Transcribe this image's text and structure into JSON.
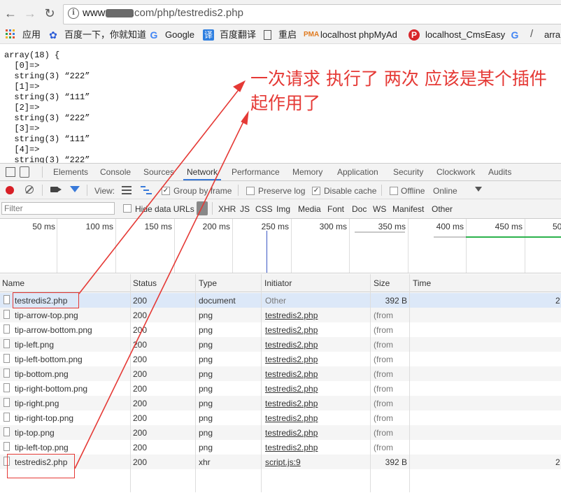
{
  "browser": {
    "url_host_prefix": "www.",
    "url_rest": ".com/php/testredis2.php"
  },
  "bookmarks": [
    {
      "label": "应用",
      "icon": "apps-grid-icon"
    },
    {
      "label": "百度一下，你就知道",
      "icon": "baidu-paw-icon"
    },
    {
      "label": "Google",
      "icon": "google-icon"
    },
    {
      "label": "百度翻译",
      "icon": "baidu-translate-icon"
    },
    {
      "label": "重启",
      "icon": "page-icon"
    },
    {
      "label": "localhost phpMyAd",
      "icon": "phpmyadmin-icon"
    },
    {
      "label": "localhost_CmsEasy",
      "icon": "cmseasy-icon"
    },
    {
      "label": "arra",
      "icon": "google-icon"
    }
  ],
  "page": {
    "dump_text": "array(18) {\n  [0]=>\n  string(3) “222”\n  [1]=>\n  string(3) “111”\n  [2]=>\n  string(3) “222”\n  [3]=>\n  string(3) “111”\n  [4]=>\n  string(3) “222”",
    "annotation": "一次请求 执行了 两次 应该是某个插件起作用了"
  },
  "devtools": {
    "tabs": [
      "Elements",
      "Console",
      "Sources",
      "Network",
      "Performance",
      "Memory",
      "Application",
      "Security",
      "Clockwork",
      "Audits"
    ],
    "active_tab": "Network",
    "toolbar": {
      "view_label": "View:",
      "group_by_frame": "Group by frame",
      "preserve_log": "Preserve log",
      "disable_cache": "Disable cache",
      "offline": "Offline",
      "throttle": "Online"
    },
    "filter": {
      "placeholder": "Filter",
      "hide_data_urls": "Hide data URLs",
      "types": [
        "XHR",
        "JS",
        "CSS",
        "Img",
        "Media",
        "Font",
        "Doc",
        "WS",
        "Manifest",
        "Other"
      ]
    },
    "timeline_ticks": [
      "50 ms",
      "100 ms",
      "150 ms",
      "200 ms",
      "250 ms",
      "300 ms",
      "350 ms",
      "400 ms",
      "450 ms",
      "50"
    ],
    "columns": [
      "Name",
      "Status",
      "Type",
      "Initiator",
      "Size",
      "Time"
    ],
    "rows": [
      {
        "name": "testredis2.php",
        "status": "200",
        "type": "document",
        "initiator": "Other",
        "size": "392 B",
        "time": "2"
      },
      {
        "name": "tip-arrow-top.png",
        "status": "200",
        "type": "png",
        "initiator": "testredis2.php",
        "size": "(from",
        "time": ""
      },
      {
        "name": "tip-arrow-bottom.png",
        "status": "200",
        "type": "png",
        "initiator": "testredis2.php",
        "size": "(from",
        "time": ""
      },
      {
        "name": "tip-left.png",
        "status": "200",
        "type": "png",
        "initiator": "testredis2.php",
        "size": "(from",
        "time": ""
      },
      {
        "name": "tip-left-bottom.png",
        "status": "200",
        "type": "png",
        "initiator": "testredis2.php",
        "size": "(from",
        "time": ""
      },
      {
        "name": "tip-bottom.png",
        "status": "200",
        "type": "png",
        "initiator": "testredis2.php",
        "size": "(from",
        "time": ""
      },
      {
        "name": "tip-right-bottom.png",
        "status": "200",
        "type": "png",
        "initiator": "testredis2.php",
        "size": "(from",
        "time": ""
      },
      {
        "name": "tip-right.png",
        "status": "200",
        "type": "png",
        "initiator": "testredis2.php",
        "size": "(from",
        "time": ""
      },
      {
        "name": "tip-right-top.png",
        "status": "200",
        "type": "png",
        "initiator": "testredis2.php",
        "size": "(from",
        "time": ""
      },
      {
        "name": "tip-top.png",
        "status": "200",
        "type": "png",
        "initiator": "testredis2.php",
        "size": "(from",
        "time": ""
      },
      {
        "name": "tip-left-top.png",
        "status": "200",
        "type": "png",
        "initiator": "testredis2.php",
        "size": "(from",
        "time": ""
      },
      {
        "name": "testredis2.php",
        "status": "200",
        "type": "xhr",
        "initiator": "script.js:9",
        "size": "392 B",
        "time": "2"
      }
    ]
  },
  "colors": {
    "annotation_red": "#e53935",
    "record_red": "#d81f26",
    "accent_blue": "#3879d9"
  }
}
